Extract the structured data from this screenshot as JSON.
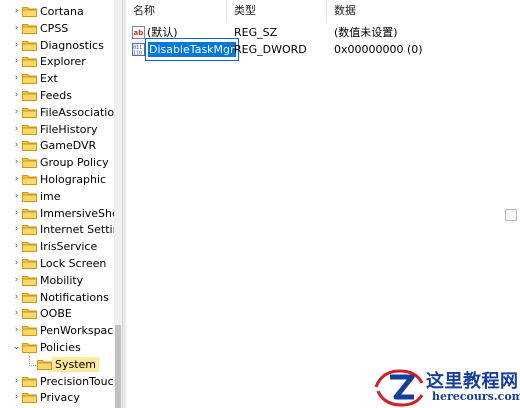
{
  "tree": {
    "items": [
      {
        "label": "Cortana"
      },
      {
        "label": "CPSS"
      },
      {
        "label": "Diagnostics"
      },
      {
        "label": "Explorer"
      },
      {
        "label": "Ext"
      },
      {
        "label": "Feeds"
      },
      {
        "label": "FileAssociation"
      },
      {
        "label": "FileHistory"
      },
      {
        "label": "GameDVR"
      },
      {
        "label": "Group Policy"
      },
      {
        "label": "Holographic"
      },
      {
        "label": "ime"
      },
      {
        "label": "ImmersiveShell"
      },
      {
        "label": "Internet Settings"
      },
      {
        "label": "IrisService"
      },
      {
        "label": "Lock Screen"
      },
      {
        "label": "Mobility"
      },
      {
        "label": "Notifications"
      },
      {
        "label": "OOBE"
      },
      {
        "label": "PenWorkspace"
      },
      {
        "label": "Policies",
        "expanded": true
      },
      {
        "label": "System",
        "child": true,
        "selected": true
      },
      {
        "label": "PrecisionTouchPad"
      },
      {
        "label": "Privacy"
      }
    ]
  },
  "columns": {
    "name": "名称",
    "type": "类型",
    "data": "数据"
  },
  "values": [
    {
      "name": "(默认)",
      "type": "REG_SZ",
      "data": "(数值未设置)",
      "icon": "string-value-icon"
    },
    {
      "name": "DisableTaskMgr",
      "type": "REG_DWORD",
      "data": "0x00000000 (0)",
      "icon": "dword-value-icon",
      "editing": true
    }
  ],
  "watermark": {
    "main": "这里教程网",
    "sub": "herecours.com"
  }
}
